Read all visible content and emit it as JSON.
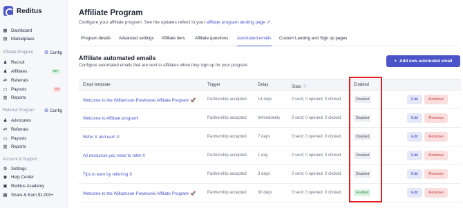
{
  "brand": {
    "name": "Reditus"
  },
  "sidebar": {
    "items": [
      {
        "label": "Dashboard",
        "icon": "grid-icon"
      },
      {
        "label": "Marketplace",
        "icon": "store-icon"
      }
    ],
    "affiliate_section": {
      "title": "Affiliate Program",
      "config_label": "Config",
      "items": [
        {
          "label": "Recruit",
          "icon": "users-icon"
        },
        {
          "label": "Affiliates",
          "icon": "users-icon",
          "badge": "99+"
        },
        {
          "label": "Referrals",
          "icon": "link-icon"
        },
        {
          "label": "Payouts",
          "icon": "money-icon",
          "badge": "70"
        },
        {
          "label": "Reports",
          "icon": "chart-icon"
        }
      ]
    },
    "referral_section": {
      "title": "Referral Program",
      "config_label": "Config",
      "items": [
        {
          "label": "Advocates",
          "icon": "users-icon"
        },
        {
          "label": "Referrals",
          "icon": "link-icon"
        },
        {
          "label": "Payouts",
          "icon": "money-icon"
        },
        {
          "label": "Reports",
          "icon": "chart-icon"
        }
      ]
    },
    "account_section": {
      "title": "Account & Support",
      "items": [
        {
          "label": "Settings",
          "icon": "gear-icon"
        },
        {
          "label": "Help Center",
          "icon": "help-icon"
        },
        {
          "label": "Reditus Academy",
          "icon": "academy-icon"
        },
        {
          "label": "Share & Earn $1,000+",
          "icon": "gift-icon"
        }
      ]
    }
  },
  "header": {
    "title": "Affiliate Program",
    "subtitle_prefix": "Configure your affiliate program. See the updates reflect in your",
    "subtitle_link": "affiliate program landing page",
    "subtitle_suffix": "."
  },
  "tabs": [
    {
      "label": "Program details",
      "active": false
    },
    {
      "label": "Advanced settings",
      "active": false
    },
    {
      "label": "Affiliate tiers",
      "active": false
    },
    {
      "label": "Affiliate questions",
      "active": false
    },
    {
      "label": "Automated emails",
      "active": true
    },
    {
      "label": "Custom Landing and Sign up pages",
      "active": false
    }
  ],
  "section": {
    "title": "Affiliate automated emails",
    "subtitle": "Configure automated emails that are sent to affiliates when they sign up for your program.",
    "add_button": "Add new automated email"
  },
  "table": {
    "headers": {
      "template": "Email template",
      "trigger": "Trigger",
      "delay": "Delay",
      "stats": "Stats",
      "enabled": "Enabled"
    },
    "rows": [
      {
        "template": "Welcome to the Williamson-Powlowski Affiliate Program! 🚀",
        "trigger": "Partnership accepted",
        "delay": "14 days",
        "stats": "0 sent; 0 opened; 0 clicked",
        "enabled": "Disabled",
        "status": "disabled"
      },
      {
        "template": "Welcome to Affiliate program!",
        "trigger": "Partnership accepted",
        "delay": "Immediately",
        "stats": "0 sent; 0 opened; 0 clicked",
        "enabled": "Disabled",
        "status": "disabled"
      },
      {
        "template": "Refer X and earn X",
        "trigger": "Partnership accepted",
        "delay": "7 days",
        "stats": "0 sent; 0 opened; 0 clicked",
        "enabled": "Disabled",
        "status": "disabled"
      },
      {
        "template": "All resources you need to refer X",
        "trigger": "Partnership accepted",
        "delay": "1 day",
        "stats": "0 sent; 0 opened; 0 clicked",
        "enabled": "Disabled",
        "status": "disabled"
      },
      {
        "template": "Tips to earn by referring X",
        "trigger": "Partnership accepted",
        "delay": "3 days",
        "stats": "0 sent; 0 opened; 0 clicked",
        "enabled": "Disabled",
        "status": "disabled"
      },
      {
        "template": "Welcome to the Williamson-Powlowski Affiliate Program! 🚀",
        "trigger": "Partnership accepted",
        "delay": "30 days",
        "stats": "0 sent; 0 opened; 0 clicked",
        "enabled": "Enabled",
        "status": "enabled"
      }
    ],
    "edit_label": "Edit",
    "remove_label": "Remove"
  },
  "colors": {
    "accent": "#4b54c9",
    "highlight": "#e02020",
    "danger": "#c13838",
    "success": "#2e8b4a"
  }
}
